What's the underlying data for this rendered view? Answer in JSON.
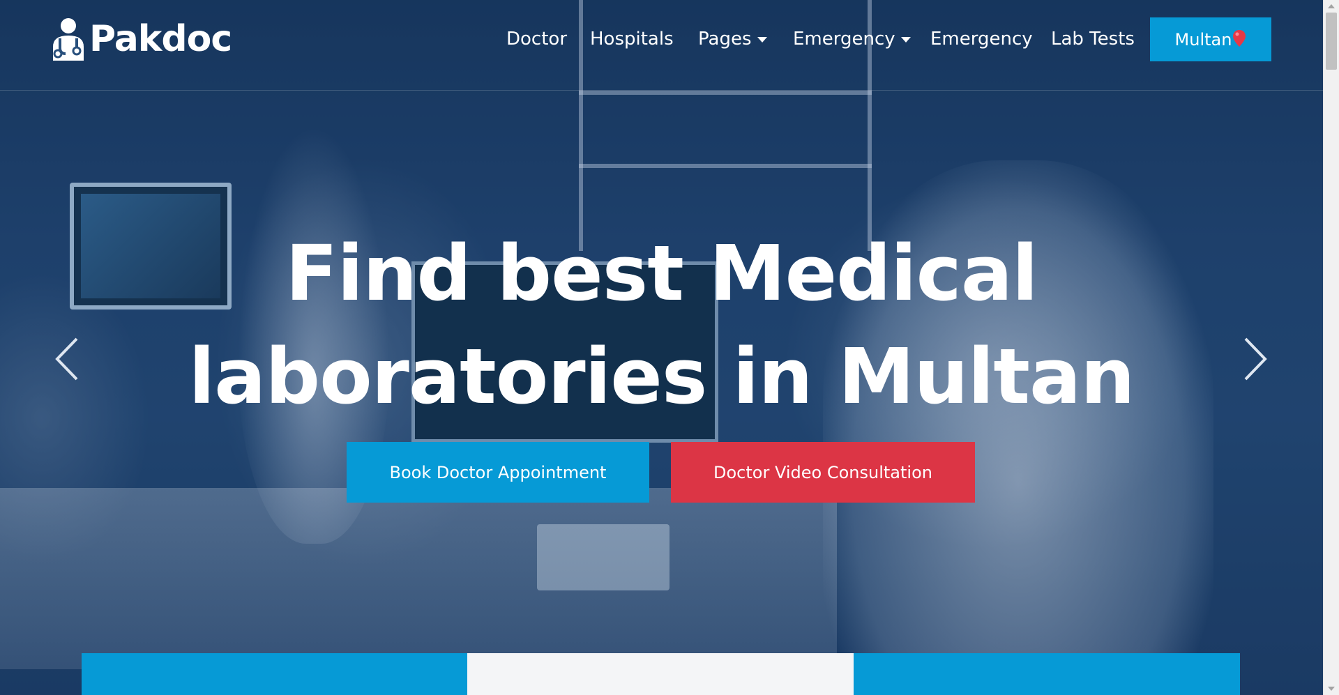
{
  "brand": {
    "name": "Pakdoc",
    "icon": "doctor-stethoscope-icon"
  },
  "nav": {
    "items": [
      {
        "label": "Doctor",
        "has_dropdown": false
      },
      {
        "label": "Hospitals",
        "has_dropdown": false
      },
      {
        "label": "Pages",
        "has_dropdown": true
      },
      {
        "label": "Emergency",
        "has_dropdown": true
      },
      {
        "label": "Emergency",
        "has_dropdown": false
      },
      {
        "label": "Lab Tests",
        "has_dropdown": false
      }
    ],
    "city_button": {
      "label": "Multan",
      "icon": "map-pin-icon"
    }
  },
  "hero": {
    "headline_line1": "Find best Medical",
    "headline_line2": "laboratories in Multan",
    "prev_icon": "chevron-left-icon",
    "next_icon": "chevron-right-icon"
  },
  "cta": {
    "book": "Book Doctor Appointment",
    "video": "Doctor Video Consultation"
  },
  "colors": {
    "primary": "#069ad6",
    "danger": "#dc3545",
    "overlay": "#1d3f66",
    "text": "#ffffff"
  }
}
